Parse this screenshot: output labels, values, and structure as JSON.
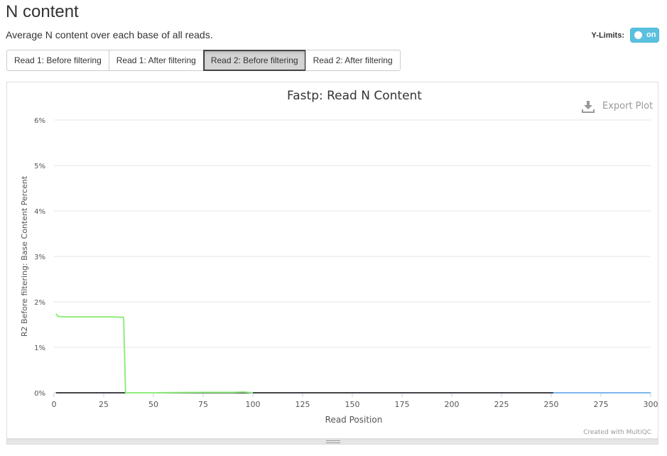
{
  "section": {
    "title": "N content",
    "description": "Average N content over each base of all reads."
  },
  "ylimits": {
    "label": "Y-Limits:",
    "toggle_text": "on",
    "state": true
  },
  "tabs": [
    {
      "label": "Read 1: Before filtering",
      "active": false
    },
    {
      "label": "Read 1: After filtering",
      "active": false
    },
    {
      "label": "Read 2: Before filtering",
      "active": true
    },
    {
      "label": "Read 2: After filtering",
      "active": false
    }
  ],
  "plot": {
    "export_label": "Export Plot",
    "credit": "Created with MultiQC"
  },
  "chart_data": {
    "type": "line",
    "title": "Fastp: Read N Content",
    "xlabel": "Read Position",
    "ylabel": "R2 Before filtering: Base Content Percent",
    "xlim": [
      0,
      300
    ],
    "ylim": [
      0,
      6
    ],
    "xticks": [
      0,
      25,
      50,
      75,
      100,
      125,
      150,
      175,
      200,
      225,
      250,
      275,
      300
    ],
    "xtick_labels": [
      "0",
      "25",
      "50",
      "75",
      "100",
      "125",
      "150",
      "175",
      "200",
      "225",
      "250",
      "275",
      "300"
    ],
    "yticks": [
      0,
      1,
      2,
      3,
      4,
      5,
      6
    ],
    "ytick_labels": [
      "0%",
      "1%",
      "2%",
      "3%",
      "4%",
      "5%",
      "6%"
    ],
    "grid": true,
    "series": [
      {
        "color": "#7cb5ec",
        "points": [
          [
            1,
            0
          ],
          [
            300,
            0
          ]
        ]
      },
      {
        "color": "#434348",
        "points": [
          [
            1,
            0
          ],
          [
            251,
            0
          ]
        ]
      },
      {
        "color": "#90ed7d",
        "points": [
          [
            1,
            1.74
          ],
          [
            2,
            1.68
          ],
          [
            5,
            1.67
          ],
          [
            15,
            1.67
          ],
          [
            25,
            1.67
          ],
          [
            30,
            1.67
          ],
          [
            35,
            1.66
          ],
          [
            36,
            0
          ],
          [
            50,
            0
          ],
          [
            75,
            0.01
          ],
          [
            90,
            0.01
          ],
          [
            95,
            0.02
          ],
          [
            100,
            0
          ]
        ]
      }
    ]
  }
}
